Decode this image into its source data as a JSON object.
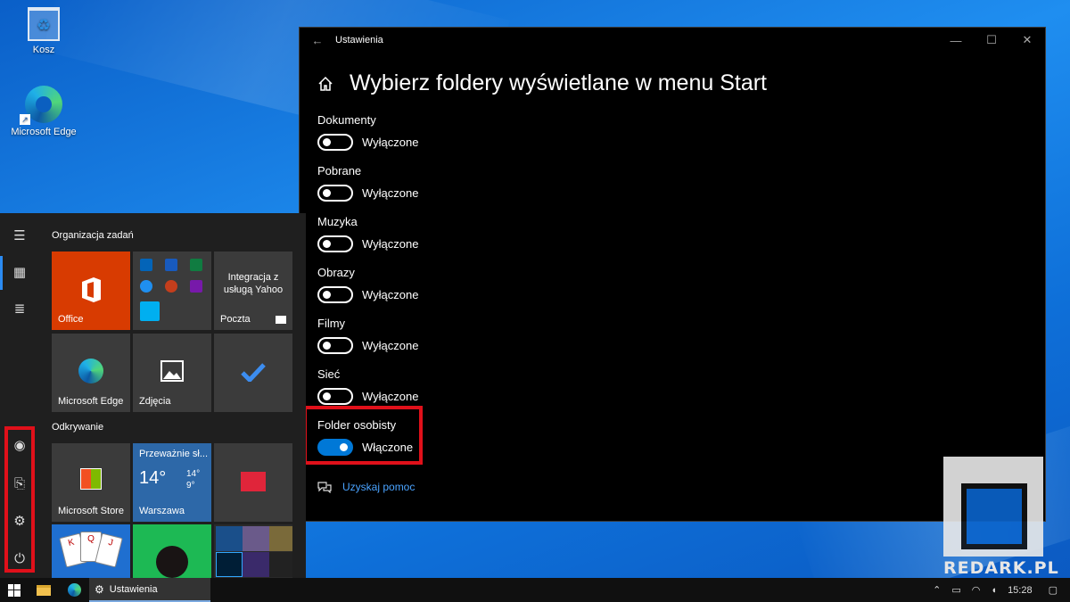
{
  "desktop": {
    "icons": [
      {
        "label": "Kosz"
      },
      {
        "label": "Microsoft Edge"
      }
    ]
  },
  "settings_window": {
    "title": "Ustawienia",
    "page_title": "Wybierz foldery wyświetlane w menu Start",
    "settings": [
      {
        "label": "Dokumenty",
        "state": "Wyłączone",
        "on": false
      },
      {
        "label": "Pobrane",
        "state": "Wyłączone",
        "on": false
      },
      {
        "label": "Muzyka",
        "state": "Wyłączone",
        "on": false
      },
      {
        "label": "Obrazy",
        "state": "Wyłączone",
        "on": false
      },
      {
        "label": "Filmy",
        "state": "Wyłączone",
        "on": false
      },
      {
        "label": "Sieć",
        "state": "Wyłączone",
        "on": false
      },
      {
        "label": "Folder osobisty",
        "state": "Włączone",
        "on": true
      }
    ],
    "help_link": "Uzyskaj pomoc",
    "highlight_color": "#e0101a",
    "accent_color": "#0078d7"
  },
  "start_menu": {
    "group1_title": "Organizacja zadań",
    "group2_title": "Odkrywanie",
    "tiles": {
      "office": "Office",
      "yahoo": "Integracja z usługą Yahoo",
      "mail": "Poczta",
      "edge": "Microsoft Edge",
      "photos": "Zdjęcia",
      "store": "Microsoft Store",
      "weather_desc": "Przeważnie sł...",
      "weather_temp": "14°",
      "weather_high": "14°",
      "weather_low": "9°",
      "weather_city": "Warszawa"
    },
    "rail_icons": [
      "hamburger-icon",
      "tiles-icon",
      "list-icon",
      "user-icon",
      "document-icon",
      "gear-icon",
      "power-icon"
    ]
  },
  "watermark": "REDARK.PL",
  "taskbar": {
    "active_app": "Ustawienia",
    "time": "15:28"
  }
}
